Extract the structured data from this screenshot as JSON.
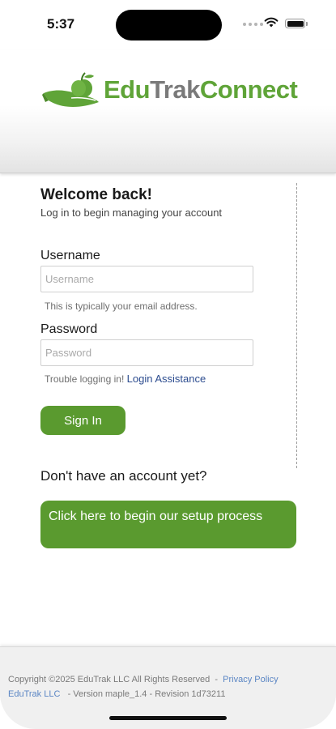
{
  "status_bar": {
    "time": "5:37",
    "signal_icon": "cellular-dots-icon",
    "wifi_icon": "wifi-icon",
    "battery_icon": "battery-icon",
    "battery_level": 1.0
  },
  "header": {
    "logo_icon": "apple-hand-logo-icon",
    "logo_part1": "Edu",
    "logo_part2": "Trak",
    "logo_part3": "Connect",
    "brand_green": "#5fa438",
    "brand_gray": "#7a7a7a"
  },
  "login": {
    "title": "Welcome back!",
    "subtitle": "Log in to begin managing your account",
    "username_label": "Username",
    "username_placeholder": "Username",
    "username_value": "",
    "username_hint": "This is typically your email address.",
    "password_label": "Password",
    "password_placeholder": "Password",
    "password_value": "",
    "trouble_text": "Trouble logging in!",
    "assistance_link": "Login Assistance",
    "signin_label": "Sign In",
    "button_color": "#5a9a2f"
  },
  "signup": {
    "prompt": "Don't have an account yet?",
    "setup_label": "Click here to begin our setup process"
  },
  "footer": {
    "copyright": "Copyright ©2025 EduTrak LLC All Rights Reserved",
    "separator": "-",
    "privacy_link": "Privacy Policy",
    "company_link": "EduTrak LLC",
    "version": "- Version maple_1.4 - Revision 1d73211"
  }
}
